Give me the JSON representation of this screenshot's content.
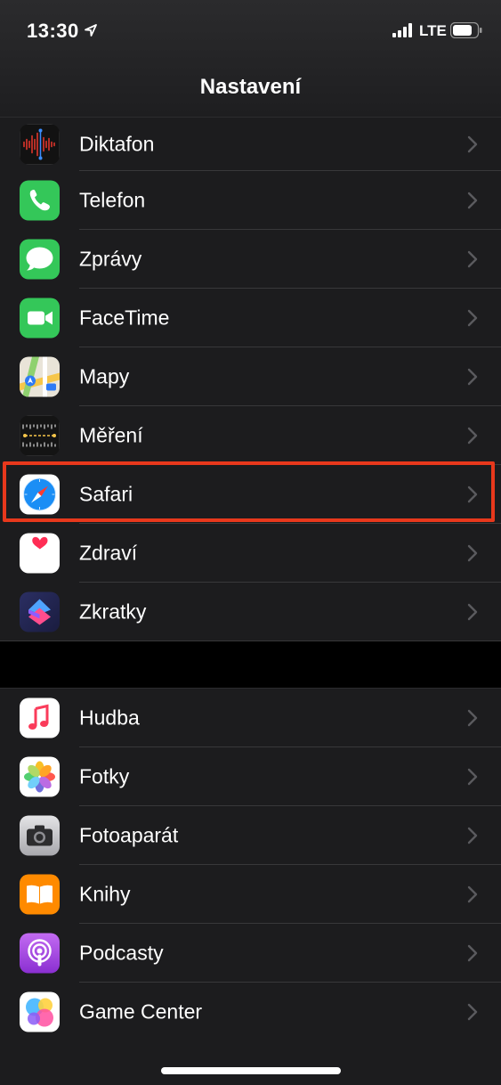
{
  "status_bar": {
    "time": "13:30",
    "network": "LTE"
  },
  "nav": {
    "title": "Nastavení"
  },
  "groups": [
    {
      "items": [
        {
          "label": "Diktafon",
          "icon": "voice-memos-icon"
        },
        {
          "label": "Telefon",
          "icon": "phone-icon"
        },
        {
          "label": "Zprávy",
          "icon": "messages-icon"
        },
        {
          "label": "FaceTime",
          "icon": "facetime-icon"
        },
        {
          "label": "Mapy",
          "icon": "maps-icon"
        },
        {
          "label": "Měření",
          "icon": "measure-icon"
        },
        {
          "label": "Safari",
          "icon": "safari-icon",
          "highlighted": true
        },
        {
          "label": "Zdraví",
          "icon": "health-icon"
        },
        {
          "label": "Zkratky",
          "icon": "shortcuts-icon"
        }
      ]
    },
    {
      "items": [
        {
          "label": "Hudba",
          "icon": "music-icon"
        },
        {
          "label": "Fotky",
          "icon": "photos-icon"
        },
        {
          "label": "Fotoaparát",
          "icon": "camera-icon"
        },
        {
          "label": "Knihy",
          "icon": "books-icon"
        },
        {
          "label": "Podcasty",
          "icon": "podcasts-icon"
        },
        {
          "label": "Game Center",
          "icon": "game-center-icon"
        }
      ]
    }
  ],
  "colors": {
    "highlight": "#e8381c",
    "cell_background": "#1c1c1e",
    "separator": "#38383a"
  }
}
